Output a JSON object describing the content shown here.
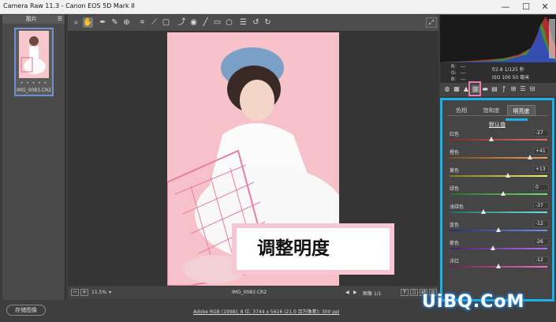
{
  "window": {
    "title": "Camera Raw 11.3 -  Canon EOS 5D Mark II",
    "min": "—",
    "max": "☐",
    "close": "✕"
  },
  "filmstrip": {
    "header": "胶片",
    "thumb_name": "IMG_0083.CR2",
    "rating": "• • • • •"
  },
  "toolbar": {
    "tools": [
      "zoom-icon",
      "hand-icon",
      "white-balance-icon",
      "color-sampler-icon",
      "targeted-adjust-icon",
      "crop-icon",
      "straighten-icon",
      "transform-icon",
      "spot-removal-icon",
      "red-eye-icon",
      "adjustment-brush-icon",
      "graduated-filter-icon",
      "radial-filter-icon",
      "preferences-icon",
      "rotate-left-icon",
      "rotate-right-icon"
    ],
    "fullscreen": "⤢"
  },
  "photo": {
    "caption": "调整明度"
  },
  "status": {
    "zoom": "11.5%",
    "filename": "IMG_0083.CR2",
    "image_count": "图像 1/1"
  },
  "bottom": {
    "save": "存储图像",
    "workflow": "Adobe RGB (1998); 8 位; 3744 x 5616 (21.0 百万像素); 300 ppi"
  },
  "info": {
    "r": "R:",
    "g": "G:",
    "b": "B:",
    "dash": "---",
    "exposure": "f/2.8   1/125 秒",
    "iso": "ISO 100   50 毫米"
  },
  "panel": {
    "tabs": [
      "色相",
      "饱和度",
      "明亮度"
    ],
    "active_tab": 2,
    "defaults": "默认值",
    "sliders": [
      {
        "label": "红色",
        "value": "-27",
        "pos": 0.43,
        "colors": [
          "#7a2a2a",
          "#e07070"
        ]
      },
      {
        "label": "橙色",
        "value": "+41",
        "pos": 0.82,
        "colors": [
          "#7a4a20",
          "#f0a060"
        ]
      },
      {
        "label": "黄色",
        "value": "+13",
        "pos": 0.6,
        "colors": [
          "#7a7a20",
          "#f0f070"
        ]
      },
      {
        "label": "绿色",
        "value": "0",
        "pos": 0.55,
        "colors": [
          "#2a6a2a",
          "#70e070"
        ]
      },
      {
        "label": "浅绿色",
        "value": "-37",
        "pos": 0.35,
        "colors": [
          "#206a6a",
          "#70e0e0"
        ]
      },
      {
        "label": "蓝色",
        "value": "-12",
        "pos": 0.5,
        "colors": [
          "#20306a",
          "#7090f0"
        ]
      },
      {
        "label": "紫色",
        "value": "-26",
        "pos": 0.44,
        "colors": [
          "#4a206a",
          "#b070f0"
        ]
      },
      {
        "label": "洋红",
        "value": "-12",
        "pos": 0.5,
        "colors": [
          "#6a2050",
          "#f070c0"
        ]
      }
    ]
  },
  "watermark": "UiBQ.CoM"
}
